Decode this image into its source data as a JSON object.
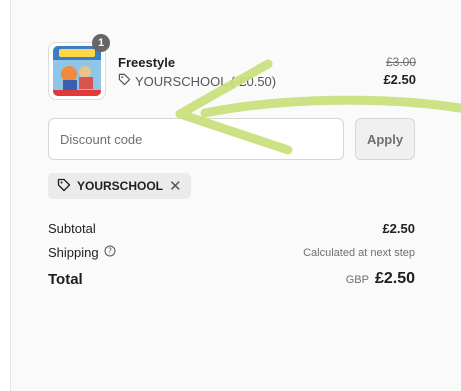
{
  "line_item": {
    "quantity": "1",
    "title": "Freestyle",
    "discount_code": "YOURSCHOOL (-£0.50)",
    "compare_price": "£3.00",
    "price": "£2.50"
  },
  "discount": {
    "placeholder": "Discount code",
    "apply_label": "Apply",
    "applied_code": "YOURSCHOOL",
    "remove_glyph": "✕"
  },
  "summary": {
    "subtotal_label": "Subtotal",
    "subtotal_value": "£2.50",
    "shipping_label": "Shipping",
    "shipping_value": "Calculated at next step",
    "total_label": "Total",
    "currency": "GBP",
    "total_value": "£2.50"
  },
  "icons": {
    "tag": "tag-icon",
    "info": "info-circle-icon",
    "close": "close-icon"
  },
  "colors": {
    "annotation_arrow": "#c8e07a",
    "badge": "#666666"
  }
}
